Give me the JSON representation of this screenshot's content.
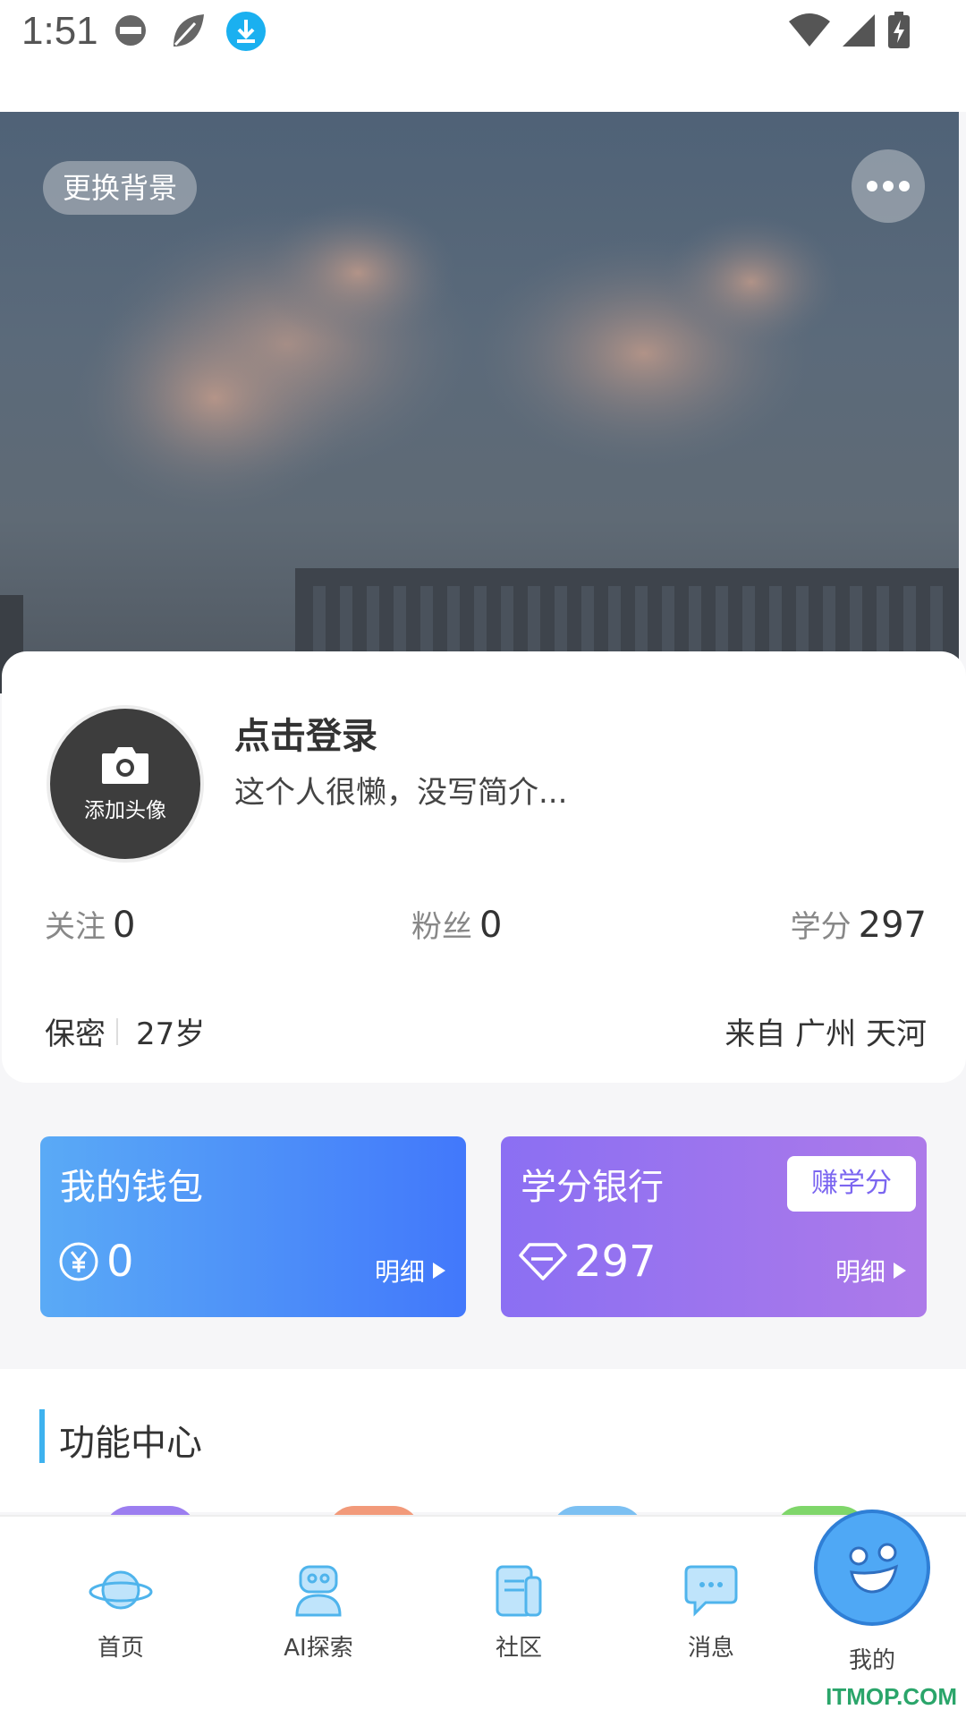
{
  "status_bar": {
    "time": "1:51"
  },
  "hero": {
    "change_bg_label": "更换背景"
  },
  "profile": {
    "avatar_label": "添加头像",
    "login_title": "点击登录",
    "bio": "这个人很懒，没写简介...",
    "stats": {
      "follow_label": "关注",
      "follow_value": "0",
      "fans_label": "粉丝",
      "fans_value": "0",
      "credits_label": "学分",
      "credits_value": "297"
    },
    "gender": "保密",
    "age": "27岁",
    "location": "来自 广州 天河"
  },
  "wallet": {
    "title": "我的钱包",
    "value": "0",
    "detail_label": "明细"
  },
  "credit_bank": {
    "title": "学分银行",
    "earn_label": "赚学分",
    "value": "297",
    "detail_label": "明细"
  },
  "function_center": {
    "title": "功能中心"
  },
  "tabbar": {
    "home": "首页",
    "ai": "AI探索",
    "community": "社区",
    "messages": "消息",
    "me": "我的"
  },
  "watermark": "ITMOP.COM",
  "colors": {
    "accent_blue": "#3eb2ef",
    "wallet_gradient_start": "#5aaaf6",
    "wallet_gradient_end": "#4278fb",
    "bank_gradient_start": "#8b6ff3",
    "bank_gradient_end": "#ad7ae9"
  }
}
